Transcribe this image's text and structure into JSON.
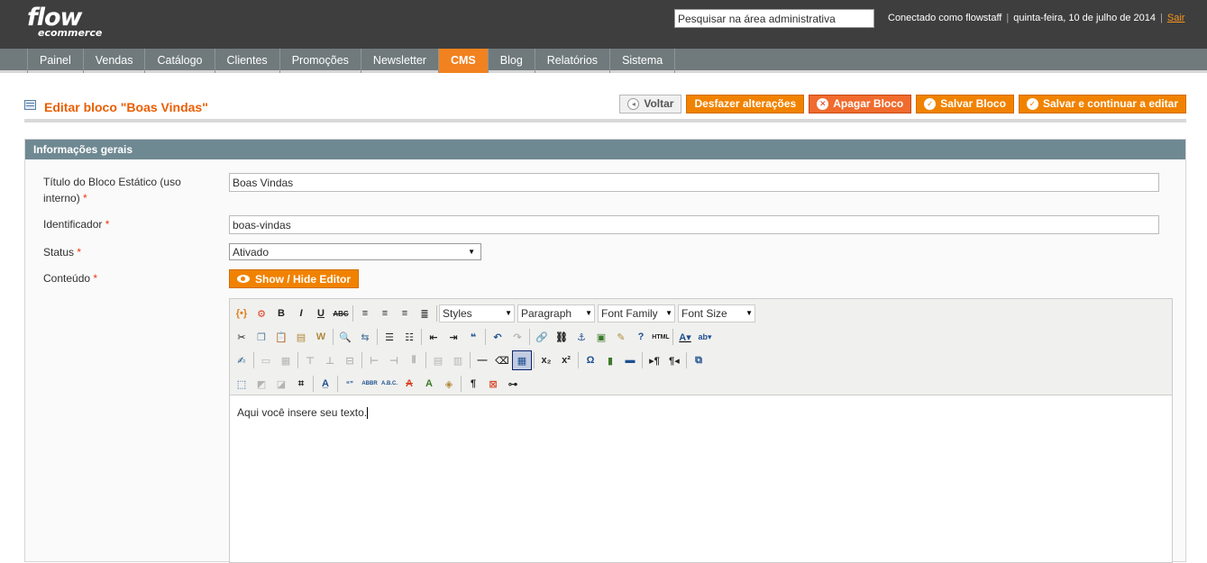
{
  "header": {
    "logo_line1": "flow",
    "logo_line2": "ecommerce",
    "search_value": "Pesquisar na área administrativa",
    "logged_in": "Conectado como flowstaff",
    "date": "quinta-feira, 10 de julho de 2014",
    "logout": "Sair"
  },
  "nav": {
    "items": [
      "Painel",
      "Vendas",
      "Catálogo",
      "Clientes",
      "Promoções",
      "Newsletter",
      "CMS",
      "Blog",
      "Relatórios",
      "Sistema"
    ],
    "active": "CMS",
    "active_color": "#f1821f"
  },
  "page": {
    "title": "Editar bloco \"Boas Vindas\"",
    "buttons": {
      "back": "Voltar",
      "reset": "Desfazer alterações",
      "delete": "Apagar Bloco",
      "save": "Salvar Bloco",
      "save_continue": "Salvar e continuar a editar"
    }
  },
  "form": {
    "section_title": "Informações gerais",
    "title_label_1": "Título do Bloco Estático (uso",
    "title_label_2": "interno)",
    "title_value": "Boas Vindas",
    "identifier_label": "Identificador",
    "identifier_value": "boas-vindas",
    "status_label": "Status",
    "status_value": "Ativado",
    "content_label": "Conteúdo",
    "required_mark": "*",
    "show_hide_editor": "Show / Hide Editor"
  },
  "editor": {
    "dropdowns": {
      "styles": "Styles",
      "paragraph": "Paragraph",
      "font_family": "Font Family",
      "font_size": "Font Size"
    },
    "content": "Aqui você insere seu texto."
  },
  "colors": {
    "header_bg": "#3e3e3e",
    "nav_bg": "#707a7d",
    "accent": "#f18200",
    "title": "#eb5e00",
    "section_head": "#6f8992"
  }
}
